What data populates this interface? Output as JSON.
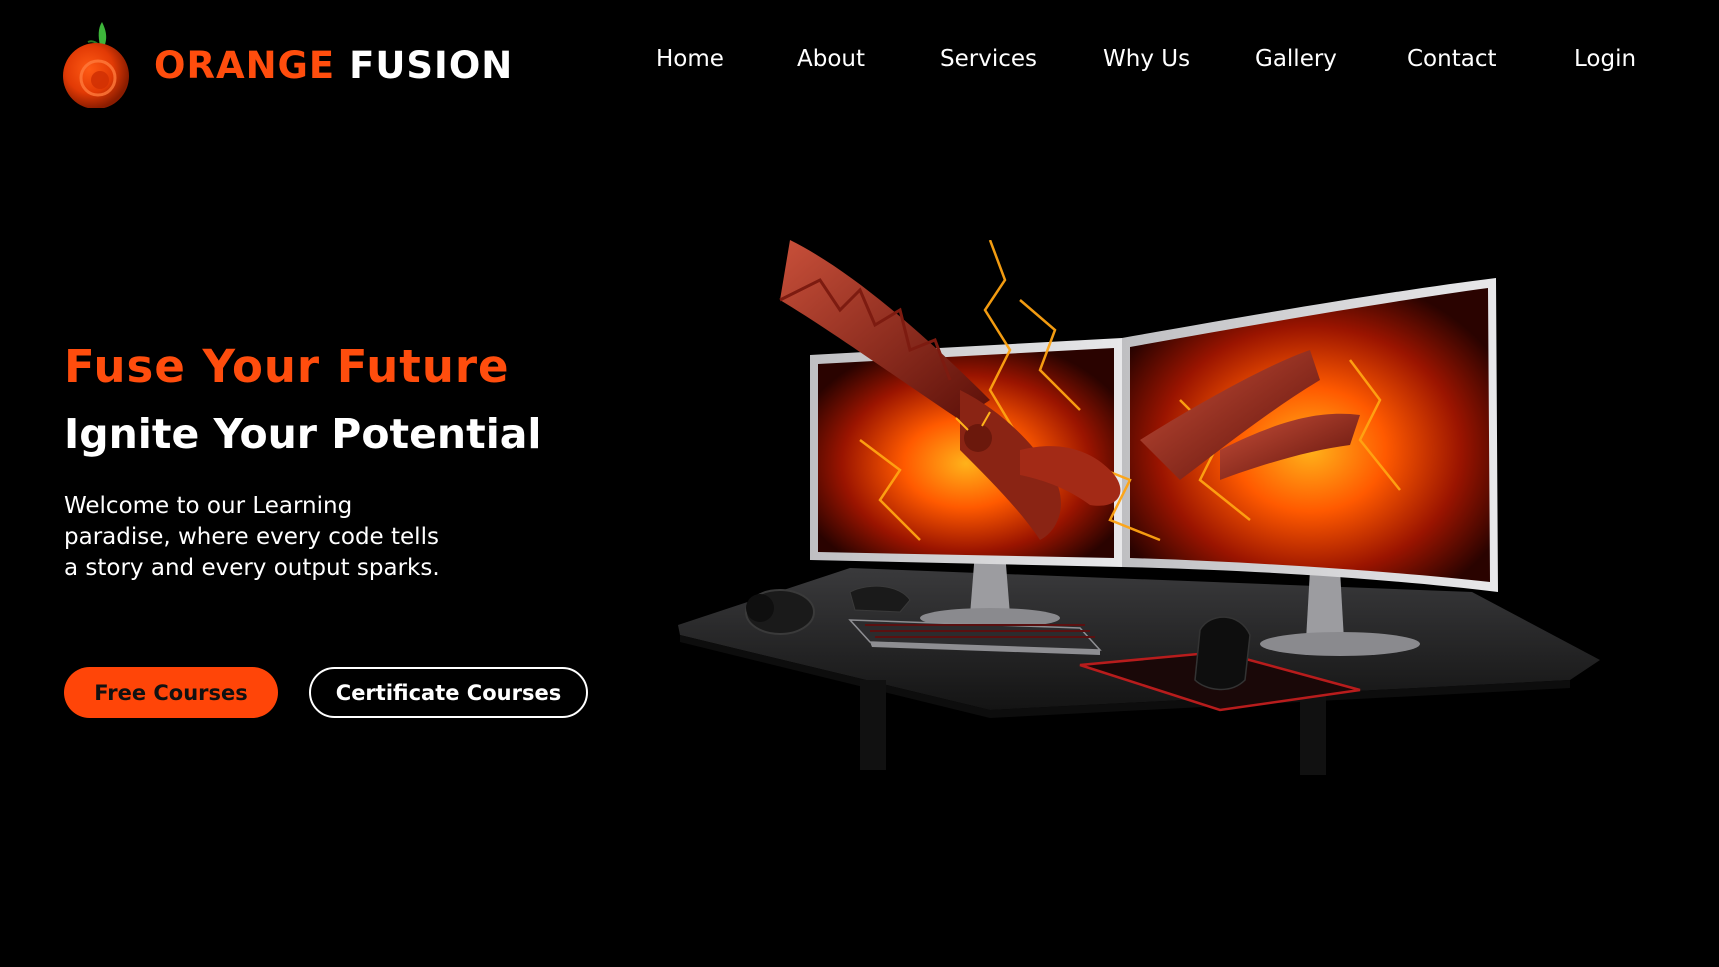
{
  "brand": {
    "name_part1": "ORANGE",
    "name_part2": "FUSION",
    "logo_icon": "orange-fruit-icon"
  },
  "nav": {
    "items": [
      {
        "label": "Home"
      },
      {
        "label": "About"
      },
      {
        "label": "Services"
      },
      {
        "label": "Why Us"
      },
      {
        "label": "Gallery"
      },
      {
        "label": "Contact"
      },
      {
        "label": "Login"
      }
    ]
  },
  "hero": {
    "title": "Fuse Your Future",
    "subtitle": "Ignite Your Potential",
    "description": "Welcome to our Learning paradise, where every code tells a story and every output sparks.",
    "primary_button": "Free Courses",
    "secondary_button": "Certificate Courses",
    "illustration": "gaming-desk-dual-monitor-fire-dragon"
  },
  "colors": {
    "accent": "#ff4d0d",
    "background": "#000000",
    "text": "#ffffff"
  }
}
